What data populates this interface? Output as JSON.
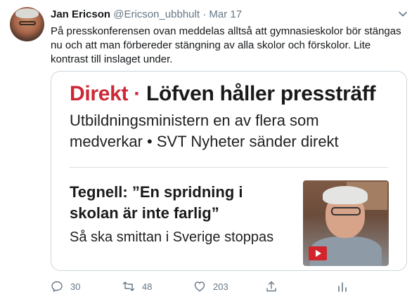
{
  "tweet": {
    "display_name": "Jan Ericson",
    "handle": "@Ericson_ubbhult",
    "separator": "·",
    "date": "Mar 17",
    "text": "På presskonferensen ovan meddelas alltså att gymnasieskolor bör stängas nu och att man förbereder stängning av alla skolor och förskolor. Lite kontrast till inslaget under."
  },
  "card": {
    "live_label": "Direkt",
    "headline_sep": " · ",
    "headline": "Löfven håller pressträff",
    "subheadline": "Utbildningsministern en av flera som medverkar • SVT Nyheter sänder direkt",
    "story_title": "Tegnell: ”En spridning i skolan är inte farlig”",
    "story_sub": "Så ska smittan i Sverige stoppas"
  },
  "actions": {
    "replies": "30",
    "retweets": "48",
    "likes": "203"
  },
  "colors": {
    "accent_red": "#cc2936",
    "muted": "#657786",
    "border": "#ccd6dd"
  },
  "icons": [
    "chevron-down-icon",
    "reply-icon",
    "retweet-icon",
    "like-icon",
    "share-icon",
    "analytics-icon",
    "play-icon"
  ]
}
